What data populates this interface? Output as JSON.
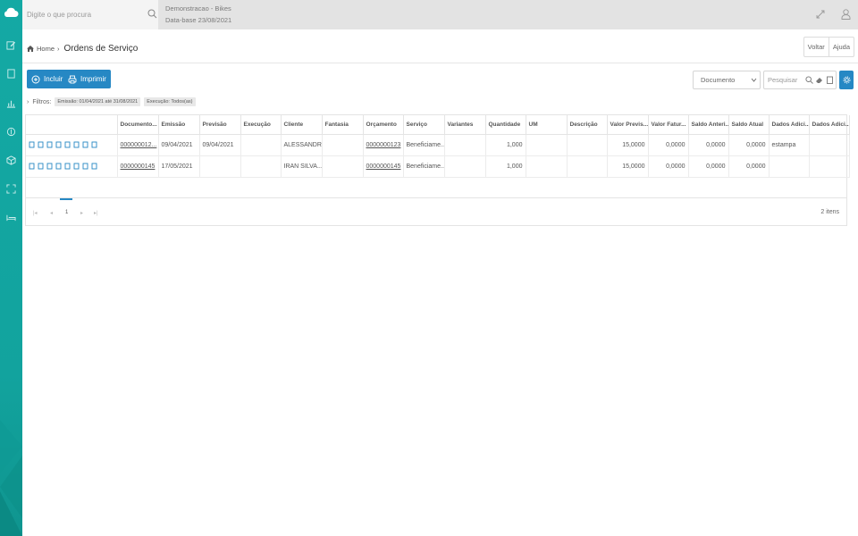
{
  "topbar": {
    "search_placeholder": "Digite o que procura",
    "company_name": "Demonstracao - Bikes",
    "base_date": "Data-base 23/08/2021"
  },
  "breadcrumb": {
    "home": "Home",
    "title": "Ordens de Serviço"
  },
  "header_buttons": {
    "back": "Voltar",
    "help": "Ajuda"
  },
  "toolbar": {
    "add_label": "Incluir",
    "print_label": "Imprimir",
    "doc_select_value": "Documento",
    "search_placeholder": "Pesquisar",
    "accent": "#2688c4"
  },
  "filters": {
    "label": "Filtros:",
    "chips": [
      "Emissão: 01/04/2021 até 31/08/2021",
      "Execução: Todos(as)"
    ]
  },
  "table": {
    "columns": [
      "Documento...",
      "Emissão",
      "Previsão",
      "Execução",
      "Cliente",
      "Fantasia",
      "Orçamento",
      "Serviço",
      "Variantes",
      "Quantidade",
      "UM",
      "Descrição",
      "Valor Previs...",
      "Valor Fatur...",
      "Saldo Anteri...",
      "Saldo Atual",
      "Dados Adici...",
      "Dados Adici..."
    ],
    "rows": [
      [
        "000000012...",
        "09/04/2021",
        "09/04/2021",
        "",
        "ALESSANDR...",
        "",
        "0000000123",
        "Beneficiame...",
        "",
        "1,000",
        "",
        "",
        "15,0000",
        "0,0000",
        "0,0000",
        "0,0000",
        "estampa",
        ""
      ],
      [
        "0000000145",
        "17/05/2021",
        "",
        "",
        "IRAN SILVA...",
        "",
        "0000000145",
        "Beneficiame...",
        "",
        "1,000",
        "",
        "",
        "15,0000",
        "0,0000",
        "0,0000",
        "0,0000",
        "",
        ""
      ]
    ]
  },
  "pager": {
    "current_page": "1",
    "count": "2 itens"
  },
  "colors": {
    "sidebar": "#14a9a4",
    "accent": "#2688c4"
  }
}
